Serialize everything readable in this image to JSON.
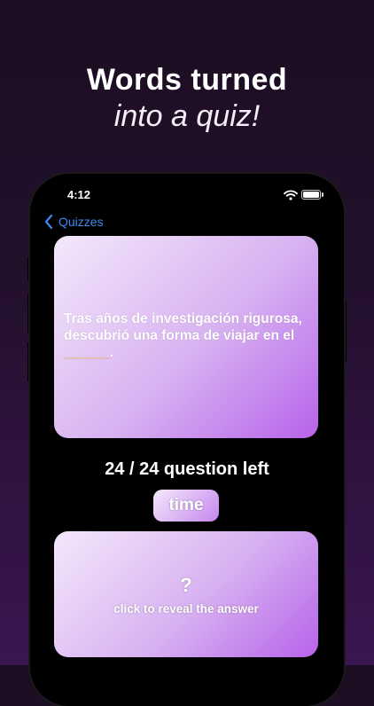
{
  "headline": {
    "line1": "Words turned",
    "line2": "into a quiz!"
  },
  "status_bar": {
    "time": "4:12"
  },
  "nav": {
    "back_label": "Quizzes"
  },
  "question_card": {
    "text": "Tras años de investigación rigurosa, descubrió una forma de viajar en el ",
    "blank": "______",
    "end": "."
  },
  "progress": {
    "counter_text": "24 / 24 question left"
  },
  "timer_button": {
    "label": "time"
  },
  "answer_card": {
    "symbol": "?",
    "hint": "click to reveal the answer"
  },
  "colors": {
    "accent_link": "#3b8cf6",
    "card_gradient_start": "#f4e8fb",
    "card_gradient_end": "#b763ea",
    "blank": "#f6c34a"
  },
  "icons": [
    "chevron-left-icon",
    "wifi-icon",
    "battery-icon"
  ]
}
